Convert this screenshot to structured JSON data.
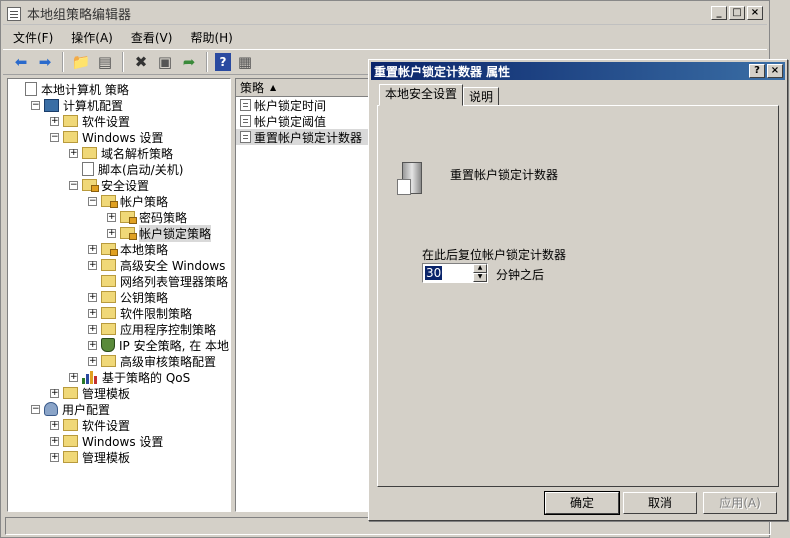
{
  "window": {
    "title": "本地组策略编辑器"
  },
  "menu": [
    "文件(F)",
    "操作(A)",
    "查看(V)",
    "帮助(H)"
  ],
  "tree": [
    {
      "label": "本地计算机 策略",
      "level": 0,
      "icon": "doc-icon",
      "exp": ""
    },
    {
      "label": "计算机配置",
      "level": 1,
      "icon": "pc-icon",
      "exp": "−"
    },
    {
      "label": "软件设置",
      "level": 2,
      "icon": "folder-icon",
      "exp": "+"
    },
    {
      "label": "Windows 设置",
      "level": 2,
      "icon": "folder-icon",
      "exp": "−"
    },
    {
      "label": "域名解析策略",
      "level": 3,
      "icon": "folder-icon",
      "exp": "+"
    },
    {
      "label": "脚本(启动/关机)",
      "level": 3,
      "icon": "doc-icon",
      "exp": ""
    },
    {
      "label": "安全设置",
      "level": 3,
      "icon": "security-folder-icon",
      "exp": "−"
    },
    {
      "label": "帐户策略",
      "level": 4,
      "icon": "security-folder-icon",
      "exp": "−"
    },
    {
      "label": "密码策略",
      "level": 5,
      "icon": "security-folder-icon",
      "exp": "+"
    },
    {
      "label": "帐户锁定策略",
      "level": 5,
      "icon": "security-folder-icon",
      "exp": "+",
      "selected": true
    },
    {
      "label": "本地策略",
      "level": 4,
      "icon": "security-folder-icon",
      "exp": "+"
    },
    {
      "label": "高级安全 Windows 防火",
      "level": 4,
      "icon": "folder-icon",
      "exp": "+"
    },
    {
      "label": "网络列表管理器策略",
      "level": 4,
      "icon": "folder-icon",
      "exp": ""
    },
    {
      "label": "公钥策略",
      "level": 4,
      "icon": "folder-icon",
      "exp": "+"
    },
    {
      "label": "软件限制策略",
      "level": 4,
      "icon": "folder-icon",
      "exp": "+"
    },
    {
      "label": "应用程序控制策略",
      "level": 4,
      "icon": "folder-icon",
      "exp": "+"
    },
    {
      "label": "IP 安全策略, 在 本地",
      "level": 4,
      "icon": "shield-icon",
      "exp": "+"
    },
    {
      "label": "高级审核策略配置",
      "level": 4,
      "icon": "folder-icon",
      "exp": "+"
    },
    {
      "label": "基于策略的 QoS",
      "level": 3,
      "icon": "chart-icon",
      "exp": "+"
    },
    {
      "label": "管理模板",
      "level": 2,
      "icon": "folder-icon",
      "exp": "+"
    },
    {
      "label": "用户配置",
      "level": 1,
      "icon": "user-icon",
      "exp": "−"
    },
    {
      "label": "软件设置",
      "level": 2,
      "icon": "folder-icon",
      "exp": "+"
    },
    {
      "label": "Windows 设置",
      "level": 2,
      "icon": "folder-icon",
      "exp": "+"
    },
    {
      "label": "管理模板",
      "level": 2,
      "icon": "folder-icon",
      "exp": "+"
    }
  ],
  "list": {
    "header": "策略",
    "items": [
      "帐户锁定时间",
      "帐户锁定阈值",
      "重置帐户锁定计数器"
    ],
    "selected_index": 2
  },
  "dialog": {
    "title": "重置帐户锁定计数器 属性",
    "tabs": [
      "本地安全设置",
      "说明"
    ],
    "policy_name": "重置帐户锁定计数器",
    "reset_label": "在此后复位帐户锁定计数器",
    "value": "30",
    "unit": "分钟之后",
    "ok": "确定",
    "cancel": "取消",
    "apply": "应用(A)"
  }
}
